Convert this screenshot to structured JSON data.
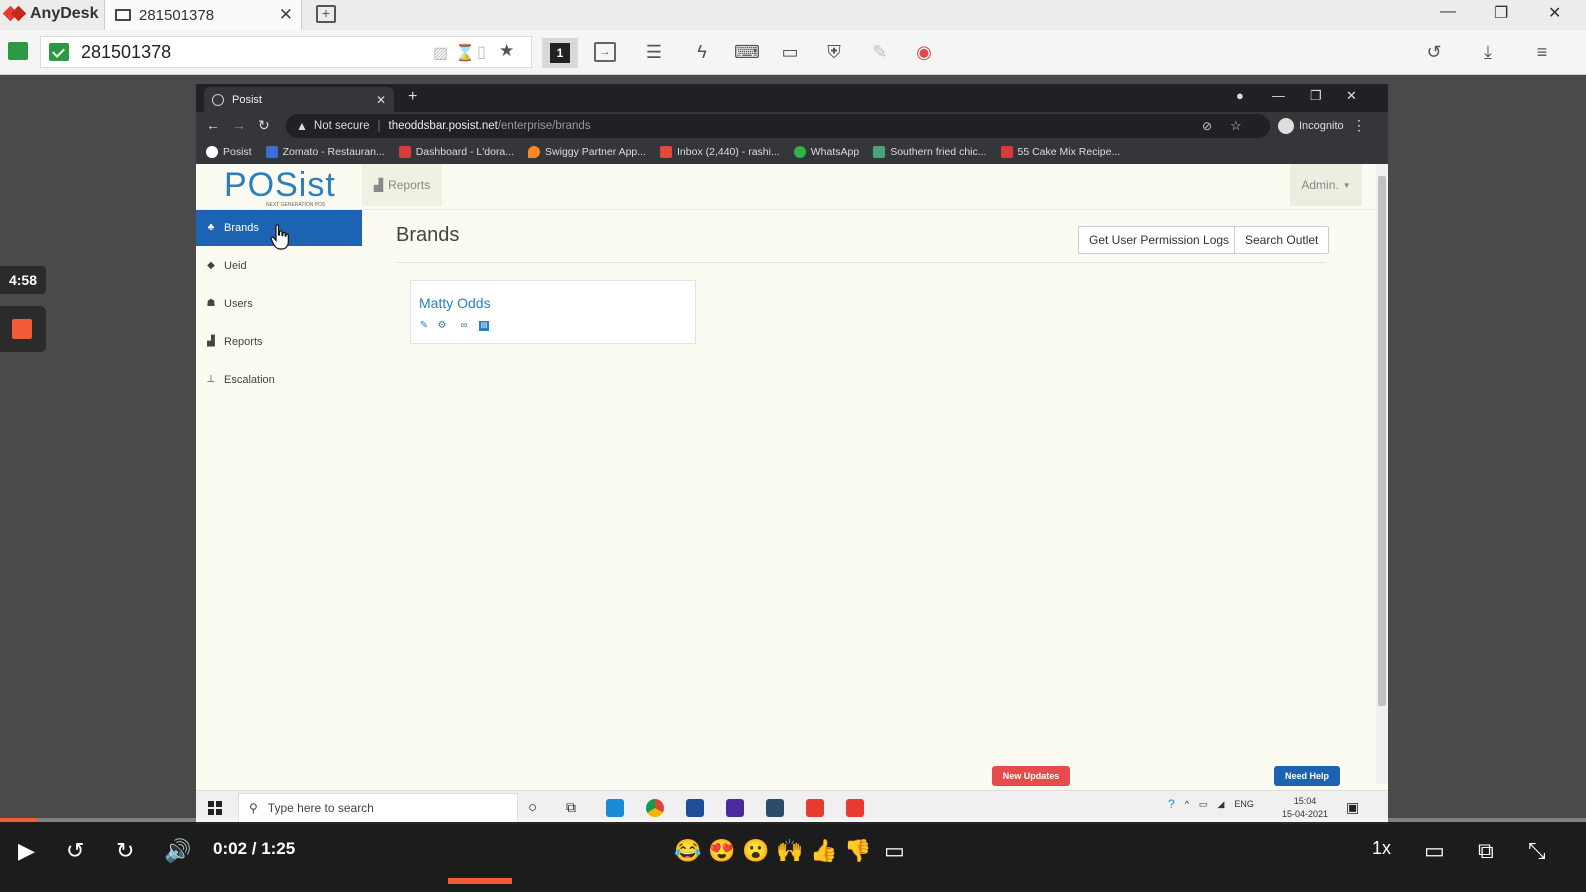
{
  "anydesk": {
    "app_name": "AnyDesk",
    "tab_title": "281501378",
    "address": "281501378"
  },
  "overlay": {
    "timer": "4:58"
  },
  "browser": {
    "tab_title": "Posist",
    "not_secure": "Not secure",
    "url_domain": "theoddsbar.posist.net",
    "url_path": "/enterprise/brands",
    "incognito": "Incognito",
    "bookmarks": [
      {
        "label": "Posist",
        "color": "#ffffff"
      },
      {
        "label": "Zomato - Restauran...",
        "color": "#3b6fd8"
      },
      {
        "label": "Dashboard - L'dora...",
        "color": "#d93a3a"
      },
      {
        "label": "Swiggy Partner App...",
        "color": "#f58a23"
      },
      {
        "label": "Inbox (2,440) - rashi...",
        "color": "#e24b3b"
      },
      {
        "label": "WhatsApp",
        "color": "#2fb344"
      },
      {
        "label": "Southern fried chic...",
        "color": "#4aa17a"
      },
      {
        "label": "55 Cake Mix Recipe...",
        "color": "#d93a3a"
      }
    ]
  },
  "posist": {
    "logo": "POSist",
    "logo_tagline": "NEXT GENERATION POS",
    "header_reports": "Reports",
    "admin": "Admin.",
    "sidebar": [
      {
        "label": "Brands",
        "icon": "brands-icon",
        "glyph": "♣"
      },
      {
        "label": "Ueid",
        "icon": "tag-icon",
        "glyph": "◆"
      },
      {
        "label": "Users",
        "icon": "users-icon",
        "glyph": "☗"
      },
      {
        "label": "Reports",
        "icon": "chart-icon",
        "glyph": "▟"
      },
      {
        "label": "Escalation",
        "icon": "sitemap-icon",
        "glyph": "⊥"
      }
    ],
    "page_title": "Brands",
    "btn_permission_logs": "Get User Permission Logs",
    "btn_search_outlet": "Search Outlet",
    "brand": {
      "name": "Matty Odds",
      "actions": [
        "edit-icon",
        "gear-icon",
        "link-icon",
        "archive-icon"
      ]
    },
    "new_updates": "New Updates",
    "need_help": "Need Help"
  },
  "taskbar": {
    "search_placeholder": "Type here to search",
    "lang": "ENG",
    "time": "15:04",
    "date": "15-04-2021"
  },
  "player": {
    "time": "0:02 / 1:25",
    "speed": "1x",
    "progress_fraction": 0.0235,
    "emojis": [
      "😂",
      "😍",
      "😮",
      "🙌",
      "👍",
      "👎"
    ]
  },
  "colors": {
    "accent_blue": "#1d63b4",
    "anydesk_red": "#e63b2e",
    "player_orange": "#f25a38"
  }
}
